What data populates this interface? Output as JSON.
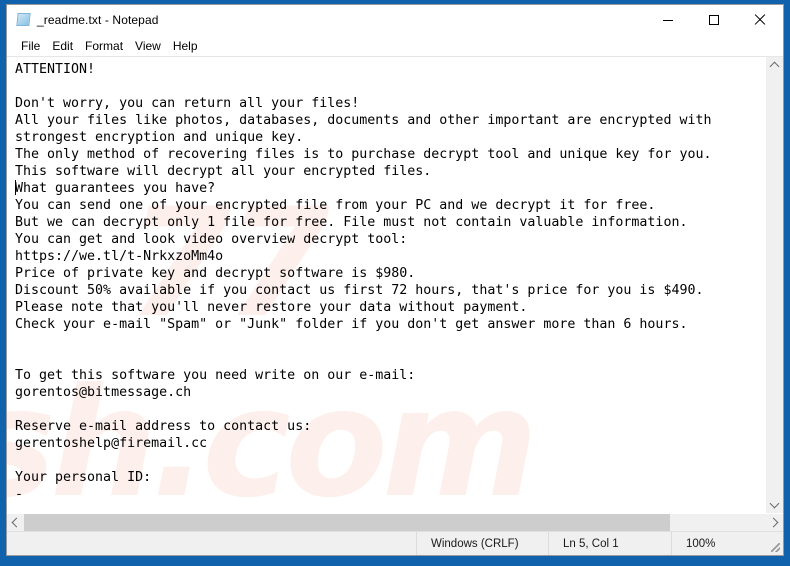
{
  "window": {
    "title": "_readme.txt - Notepad",
    "icon": "notepad-document-icon",
    "controls": {
      "minimize": "minimize-icon",
      "maximize": "maximize-icon",
      "close": "close-icon"
    }
  },
  "menu": {
    "items": [
      {
        "label": "File"
      },
      {
        "label": "Edit"
      },
      {
        "label": "Format"
      },
      {
        "label": "View"
      },
      {
        "label": "Help"
      }
    ]
  },
  "document": {
    "text": "ATTENTION!\n\nDon't worry, you can return all your files!\nAll your files like photos, databases, documents and other important are encrypted with\nstrongest encryption and unique key.\nThe only method of recovering files is to purchase decrypt tool and unique key for you.\nThis software will decrypt all your encrypted files.\nWhat guarantees you have?\nYou can send one of your encrypted file from your PC and we decrypt it for free.\nBut we can decrypt only 1 file for free. File must not contain valuable information.\nYou can get and look video overview decrypt tool:\nhttps://we.tl/t-NrkxzoMm4o\nPrice of private key and decrypt software is $980.\nDiscount 50% available if you contact us first 72 hours, that's price for you is $490.\nPlease note that you'll never restore your data without payment.\nCheck your e-mail \"Spam\" or \"Junk\" folder if you don't get answer more than 6 hours.\n\n\nTo get this software you need write on our e-mail:\ngorentos@bitmessage.ch\n\nReserve e-mail address to contact us:\ngerentoshelp@firemail.cc\n\nYour personal ID:\n-"
  },
  "watermark": {
    "line1": "77",
    "line2": "sh.com"
  },
  "status_bar": {
    "eol": "Windows (CRLF)",
    "position": "Ln 5, Col 1",
    "zoom": "100%"
  },
  "scrollbars": {
    "vertical": {
      "up": "scroll-up-icon",
      "down": "scroll-down-icon"
    },
    "horizontal": {
      "left": "scroll-left-icon",
      "right": "scroll-right-icon"
    }
  },
  "colors": {
    "desktop": "#1162ad",
    "window": "#ffffff",
    "status_bar": "#f0f0f0",
    "scrollbar_thumb": "#cdcdcd",
    "text": "#000000"
  }
}
